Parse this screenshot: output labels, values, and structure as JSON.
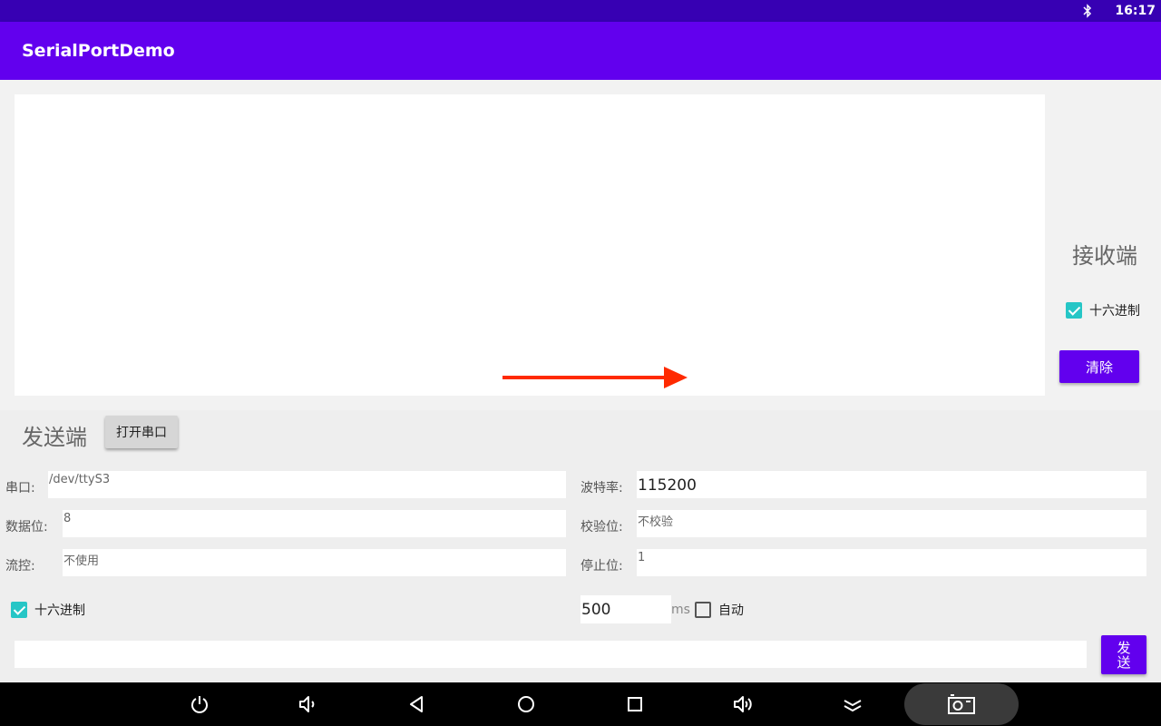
{
  "status_bar": {
    "time": "16:17",
    "icons": [
      "bluetooth-icon"
    ]
  },
  "app_bar": {
    "title": "SerialPortDemo"
  },
  "receive": {
    "title": "接收端",
    "hex_label": "十六进制",
    "hex_checked": true,
    "clear_label": "清除"
  },
  "send": {
    "title": "发送端",
    "open_port_label": "打开串口",
    "serial_port": {
      "label": "串口:",
      "value": "/dev/ttyS3"
    },
    "baud_rate": {
      "label": "波特率:",
      "value": "115200"
    },
    "data_bits": {
      "label": "数据位:",
      "value": "8"
    },
    "parity": {
      "label": "校验位:",
      "value": "不校验"
    },
    "flow_control": {
      "label": "流控:",
      "value": "不使用"
    },
    "stop_bits": {
      "label": "停止位:",
      "value": "1"
    },
    "hex_label": "十六进制",
    "hex_checked": true,
    "interval_value": "500",
    "interval_unit": "ms",
    "auto_label": "自动",
    "auto_checked": false,
    "input_value": "",
    "send_label_1": "发",
    "send_label_2": "送"
  },
  "colors": {
    "status_bar": "#3700b3",
    "app_bar": "#6200ee",
    "accent": "#26c6c6",
    "arrow": "#ff2a00"
  },
  "nav_bar": {
    "icons": [
      "power-icon",
      "volume-down-icon",
      "back-icon",
      "home-icon",
      "recents-icon",
      "volume-up-icon",
      "collapse-icon",
      "screenshot-icon"
    ]
  }
}
